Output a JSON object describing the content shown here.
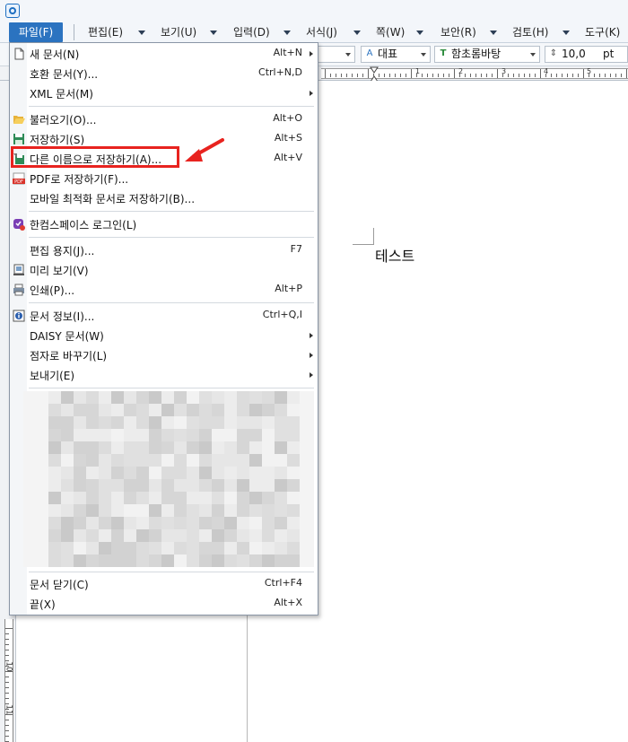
{
  "menubar": {
    "items": [
      {
        "label": "파일(F)"
      },
      {
        "label": "편집(E)"
      },
      {
        "label": "보기(U)"
      },
      {
        "label": "입력(D)"
      },
      {
        "label": "서식(J)"
      },
      {
        "label": "쪽(W)"
      },
      {
        "label": "보안(R)"
      },
      {
        "label": "검토(H)"
      },
      {
        "label": "도구(K)"
      }
    ]
  },
  "toolbar": {
    "style_value": "대표",
    "font_value": "함초롬바탕",
    "size_value": "10,0",
    "size_unit": "pt"
  },
  "ruler": {
    "numbers": [
      "1",
      "2",
      "3",
      "4",
      "5"
    ]
  },
  "vruler": {
    "numbers": [
      "10",
      "11"
    ]
  },
  "document": {
    "text": "테스트"
  },
  "file_menu": {
    "items": [
      {
        "label": "새 문서(N)",
        "shortcut": "Alt+N",
        "submenu": true,
        "icon": "new-document-icon"
      },
      {
        "label": "호환 문서(Y)...",
        "shortcut": "Ctrl+N,D",
        "submenu": false,
        "icon": ""
      },
      {
        "label": "XML 문서(M)",
        "shortcut": "",
        "submenu": true,
        "icon": ""
      },
      {
        "label": "불러오기(O)...",
        "shortcut": "Alt+O",
        "submenu": false,
        "icon": "folder-open-icon"
      },
      {
        "label": "저장하기(S)",
        "shortcut": "Alt+S",
        "submenu": false,
        "icon": "save-icon"
      },
      {
        "label": "다른 이름으로 저장하기(A)...",
        "shortcut": "Alt+V",
        "submenu": false,
        "icon": "save-as-icon"
      },
      {
        "label": "PDF로 저장하기(F)...",
        "shortcut": "",
        "submenu": false,
        "icon": "pdf-icon"
      },
      {
        "label": "모바일 최적화 문서로 저장하기(B)...",
        "shortcut": "",
        "submenu": false,
        "icon": ""
      },
      {
        "label": "한컴스페이스 로그인(L)",
        "shortcut": "",
        "submenu": false,
        "icon": "hancom-space-icon"
      },
      {
        "label": "편집 용지(J)...",
        "shortcut": "F7",
        "submenu": false,
        "icon": ""
      },
      {
        "label": "미리 보기(V)",
        "shortcut": "",
        "submenu": false,
        "icon": "preview-icon"
      },
      {
        "label": "인쇄(P)...",
        "shortcut": "Alt+P",
        "submenu": false,
        "icon": "print-icon"
      },
      {
        "label": "문서 정보(I)...",
        "shortcut": "Ctrl+Q,I",
        "submenu": false,
        "icon": "info-icon"
      },
      {
        "label": "DAISY 문서(W)",
        "shortcut": "",
        "submenu": true,
        "icon": ""
      },
      {
        "label": "점자로 바꾸기(L)",
        "shortcut": "",
        "submenu": true,
        "icon": ""
      },
      {
        "label": "보내기(E)",
        "shortcut": "",
        "submenu": true,
        "icon": ""
      },
      {
        "label": "문서 닫기(C)",
        "shortcut": "Ctrl+F4",
        "submenu": false,
        "icon": ""
      },
      {
        "label": "끝(X)",
        "shortcut": "Alt+X",
        "submenu": false,
        "icon": ""
      }
    ]
  },
  "colors": {
    "accent": "#2b73c0",
    "highlight": "#e8231f"
  }
}
